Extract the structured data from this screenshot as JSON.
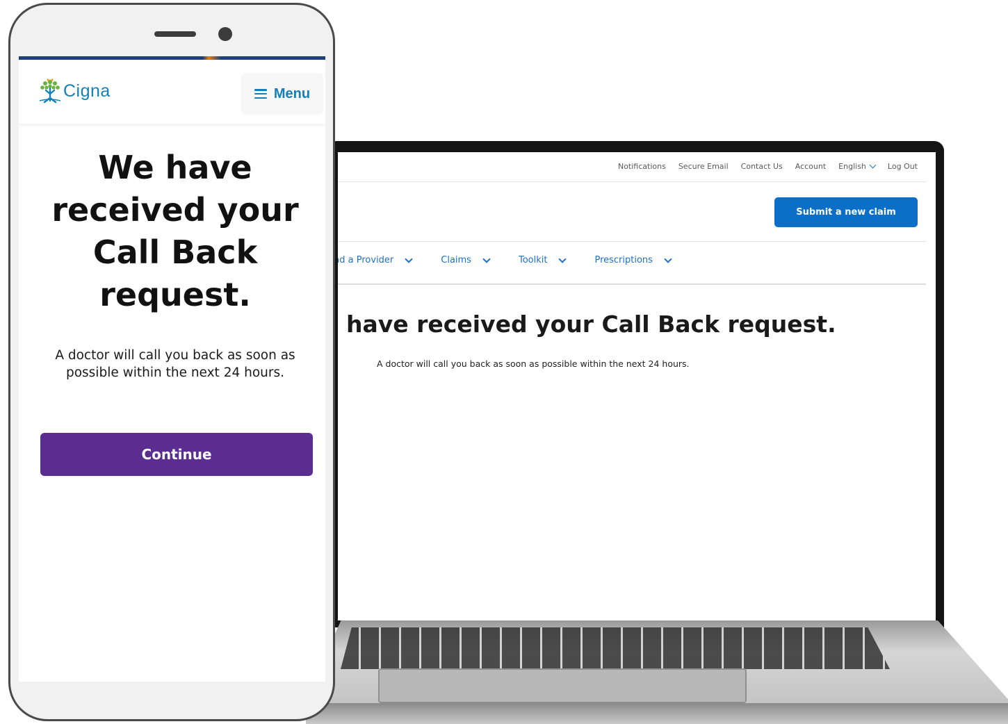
{
  "laptop": {
    "top_nav": [
      "Notifications",
      "Secure Email",
      "Contact Us",
      "Account",
      "English",
      "Log Out"
    ],
    "submit_claim_label": "Submit a new claim",
    "main_nav": [
      "nd a Provider",
      "Claims",
      "Toolkit",
      "Prescriptions"
    ],
    "heading": "have received your Call Back request.",
    "message": "A doctor will call you back as soon as possible within the next 24 hours."
  },
  "phone": {
    "logo_text": "Cigna",
    "menu_label": "Menu",
    "heading": "We have received your Call Back request.",
    "message": "A doctor will call you back as soon as possible within the next 24 hours.",
    "continue_label": "Continue"
  },
  "colors": {
    "brand_blue": "#1380b8",
    "laptop_button_blue": "#0b6fc7",
    "continue_purple": "#5b2d91"
  }
}
